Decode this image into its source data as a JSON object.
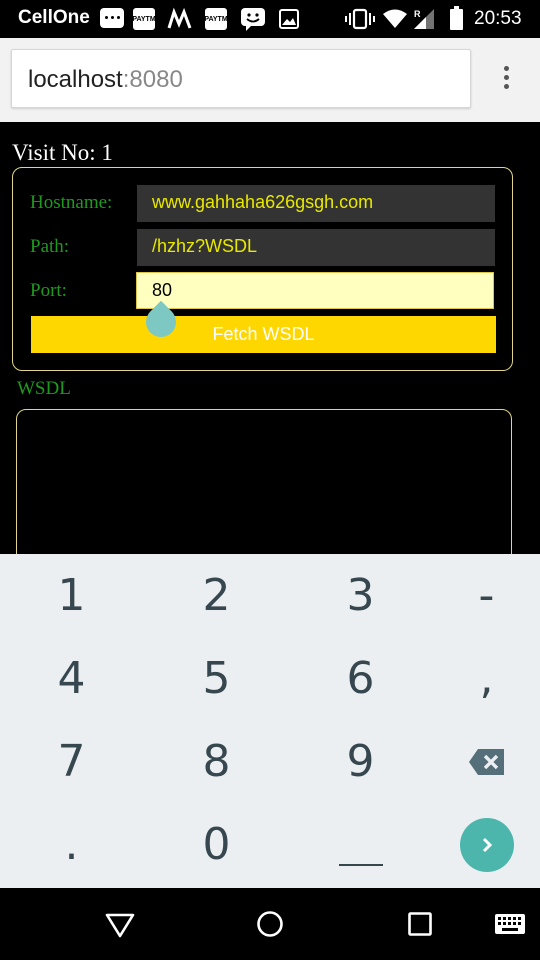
{
  "status_bar": {
    "carrier": "CellOne",
    "clock": "20:53",
    "notification_labels": [
      "PAYTM",
      "PAYTM"
    ]
  },
  "browser": {
    "url_host": "localhost",
    "url_port": ":8080"
  },
  "page": {
    "visit_text": "Visit No: 1",
    "form": {
      "hostname_label": "Hostname:",
      "hostname_value": "www.gahhaha626gsgh.com",
      "path_label": "Path:",
      "path_value": "/hzhz?WSDL",
      "port_label": "Port:",
      "port_value": "80",
      "fetch_button": "Fetch WSDL"
    },
    "wsdl_label": "WSDL"
  },
  "keyboard": {
    "row1": [
      "1",
      "2",
      "3",
      "-"
    ],
    "row2": [
      "4",
      "5",
      "6",
      ","
    ],
    "row3": [
      "7",
      "8",
      "9"
    ],
    "row4": [
      ".",
      "0",
      "␣"
    ]
  },
  "colors": {
    "label_green": "#1f9a1f",
    "field_text_yellow": "#e8e800",
    "button_yellow": "#ffd700",
    "box_border": "#e0d48a",
    "go_key": "#4db6ac"
  }
}
